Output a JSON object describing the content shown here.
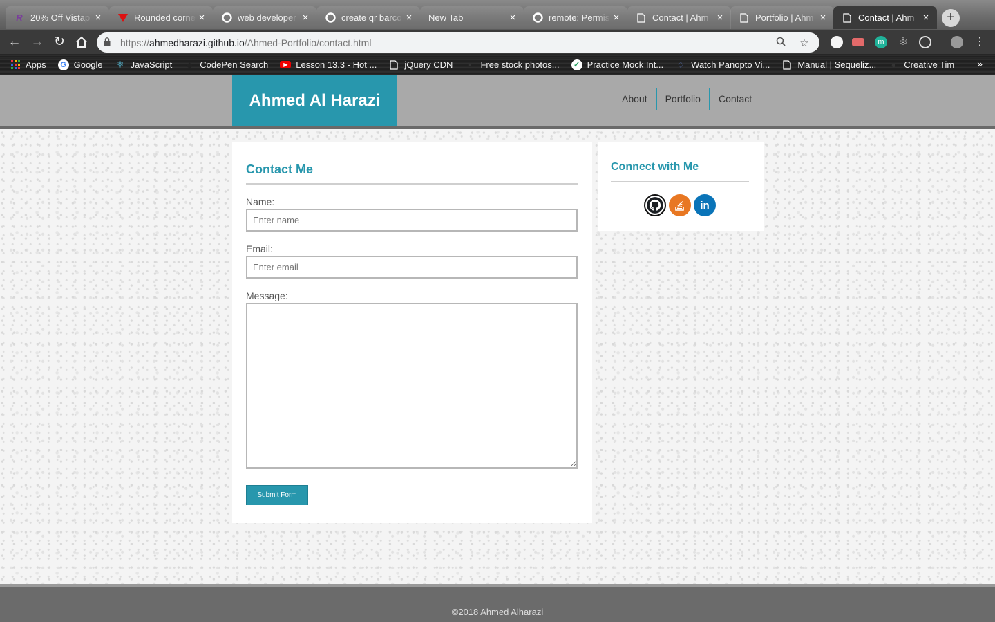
{
  "browser": {
    "tabs": [
      {
        "title": "20% Off Vistap",
        "icon": "r-logo-icon"
      },
      {
        "title": "Rounded corne",
        "icon": "vivaldi-icon"
      },
      {
        "title": "web developer",
        "icon": "google-icon"
      },
      {
        "title": "create qr barco",
        "icon": "google-icon"
      },
      {
        "title": "New Tab",
        "icon": ""
      },
      {
        "title": "remote: Permis",
        "icon": "google-icon"
      },
      {
        "title": "Contact | Ahm",
        "icon": "page-icon"
      },
      {
        "title": "Portfolio | Ahm",
        "icon": "page-icon"
      },
      {
        "title": "Contact | Ahm",
        "icon": "page-icon",
        "active": true
      }
    ],
    "url_prefix": "https://",
    "url_host": "ahmedharazi.github.io",
    "url_path": "/Ahmed-Portfolio/contact.html",
    "bookmarks": [
      {
        "label": "Apps",
        "icon": "apps-grid-icon"
      },
      {
        "label": "Google",
        "icon": "google-icon"
      },
      {
        "label": "JavaScript",
        "icon": "react-icon"
      },
      {
        "label": "CodePen Search",
        "icon": "codepen-icon"
      },
      {
        "label": "Lesson 13.3 - Hot ...",
        "icon": "youtube-icon"
      },
      {
        "label": "jQuery CDN",
        "icon": "page-icon"
      },
      {
        "label": "Free stock photos...",
        "icon": "pexels-icon"
      },
      {
        "label": "Practice Mock Int...",
        "icon": "check-icon"
      },
      {
        "label": "Watch Panopto Vi...",
        "icon": "panopto-icon"
      },
      {
        "label": "Manual | Sequeliz...",
        "icon": "page-icon"
      },
      {
        "label": "Creative Tim",
        "icon": "creative-tim-icon"
      }
    ],
    "bookmarks_more": "»"
  },
  "site": {
    "brand": "Ahmed Al Harazi",
    "nav": [
      "About",
      "Portfolio",
      "Contact"
    ],
    "accent_color": "#2897ad"
  },
  "contact": {
    "title": "Contact Me",
    "name_label": "Name:",
    "name_placeholder": "Enter name",
    "email_label": "Email:",
    "email_placeholder": "Enter email",
    "message_label": "Message:",
    "submit_label": "Submit Form"
  },
  "connect": {
    "title": "Connect with Me",
    "links": [
      {
        "name": "github",
        "icon": "github-icon",
        "color": "#000000"
      },
      {
        "name": "stackoverflow",
        "icon": "stackoverflow-icon",
        "color": "#e87722"
      },
      {
        "name": "linkedin",
        "icon": "linkedin-icon",
        "color": "#0a74b8",
        "text": "in"
      }
    ]
  },
  "footer": {
    "text": "©2018 Ahmed Alharazi"
  }
}
